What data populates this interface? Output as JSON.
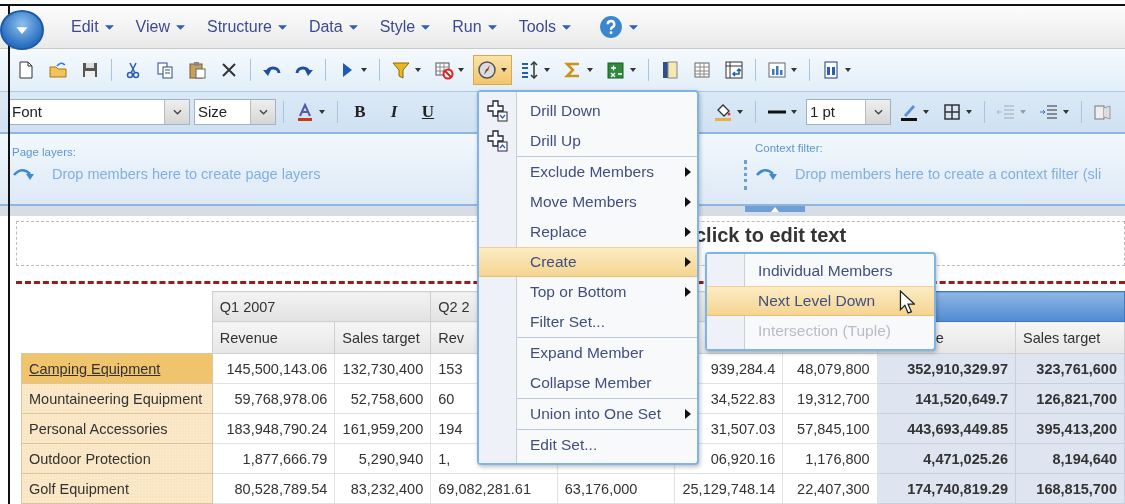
{
  "menubar": {
    "items": [
      "Edit",
      "View",
      "Structure",
      "Data",
      "Style",
      "Run",
      "Tools"
    ]
  },
  "toolbar": {
    "buttons": [
      {
        "kind": "new",
        "dropdown": false,
        "active": false
      },
      {
        "kind": "open",
        "dropdown": false,
        "active": false
      },
      {
        "kind": "save",
        "dropdown": false,
        "active": false
      },
      {
        "kind": "separator"
      },
      {
        "kind": "cut",
        "dropdown": false,
        "active": false
      },
      {
        "kind": "copy",
        "dropdown": false,
        "active": false
      },
      {
        "kind": "paste",
        "dropdown": false,
        "active": false
      },
      {
        "kind": "delete",
        "dropdown": false,
        "active": false
      },
      {
        "kind": "separator"
      },
      {
        "kind": "undo",
        "dropdown": false,
        "active": false
      },
      {
        "kind": "redo",
        "dropdown": false,
        "active": false
      },
      {
        "kind": "separator"
      },
      {
        "kind": "run",
        "dropdown": true,
        "active": false
      },
      {
        "kind": "separator"
      },
      {
        "kind": "filter",
        "dropdown": true,
        "active": false
      },
      {
        "kind": "block",
        "dropdown": true,
        "active": false
      },
      {
        "kind": "analysis",
        "dropdown": true,
        "active": true
      },
      {
        "kind": "sort",
        "dropdown": true,
        "active": false
      },
      {
        "kind": "sum",
        "dropdown": true,
        "active": false
      },
      {
        "kind": "calc",
        "dropdown": true,
        "active": false
      },
      {
        "kind": "separator"
      },
      {
        "kind": "column",
        "dropdown": false,
        "active": false
      },
      {
        "kind": "table",
        "dropdown": false,
        "active": false
      },
      {
        "kind": "swap",
        "dropdown": false,
        "active": false
      },
      {
        "kind": "separator"
      },
      {
        "kind": "chart",
        "dropdown": true,
        "active": false
      },
      {
        "kind": "separator"
      },
      {
        "kind": "document",
        "dropdown": true,
        "active": false
      }
    ]
  },
  "format_bar": {
    "items": [
      {
        "kind": "select",
        "value": "Font"
      },
      {
        "kind": "select",
        "value": "Size"
      },
      {
        "kind": "separator"
      },
      {
        "kind": "font-color",
        "dropdown": true,
        "disabled": false
      },
      {
        "kind": "separator"
      },
      {
        "kind": "bold",
        "label": "B",
        "disabled": false
      },
      {
        "kind": "italic",
        "label": "I",
        "disabled": false
      },
      {
        "kind": "underline",
        "label": "U",
        "disabled": false
      },
      {
        "kind": "hidden"
      },
      {
        "kind": "fill",
        "dropdown": true,
        "disabled": false
      },
      {
        "kind": "separator"
      },
      {
        "kind": "line",
        "dropdown": true,
        "disabled": false
      },
      {
        "kind": "select",
        "value": "1 pt"
      },
      {
        "kind": "pen",
        "dropdown": true,
        "disabled": false
      },
      {
        "kind": "borders",
        "dropdown": true,
        "disabled": false
      },
      {
        "kind": "separator"
      },
      {
        "kind": "outdent",
        "dropdown": true,
        "disabled": true
      },
      {
        "kind": "indent",
        "dropdown": true,
        "disabled": false
      },
      {
        "kind": "separator"
      },
      {
        "kind": "style",
        "dropdown": false,
        "disabled": false
      }
    ]
  },
  "page_layers": {
    "label": "Page layers:",
    "hint": "Drop members here to create page layers"
  },
  "context_filter": {
    "label": "Context filter:",
    "hint": "Drop members here to create a context filter (sli"
  },
  "report_title": {
    "text": "click to edit text"
  },
  "table": {
    "groups": [
      {
        "kind": "normal",
        "label": "Q1 2007",
        "headers": [
          "Revenue",
          "Sales target"
        ]
      },
      {
        "kind": "cut",
        "label": "Q2 2",
        "headers": [
          "Rev"
        ]
      },
      {
        "kind": "hidden"
      },
      {
        "kind": "summary",
        "headers": [
          "e",
          "Sales target"
        ]
      }
    ],
    "rows": [
      {
        "label": "Camping Equipment",
        "selected": true,
        "cells": [
          "145,500,143.06",
          "132,730,400",
          "153",
          null,
          "939,284.4",
          "48,079,800",
          "352,910,329.97",
          "323,761,600"
        ]
      },
      {
        "label": "Mountaineering Equipment",
        "selected": false,
        "cells": [
          "59,768,978.06",
          "52,758,600",
          "60",
          null,
          "34,522.83",
          "19,312,700",
          "141,520,649.7",
          "126,821,700"
        ]
      },
      {
        "label": "Personal Accessories",
        "selected": false,
        "cells": [
          "183,948,790.24",
          "161,959,200",
          "194",
          null,
          "31,507.03",
          "57,845,100",
          "443,693,449.85",
          "395,413,200"
        ]
      },
      {
        "label": "Outdoor Protection",
        "selected": false,
        "cells": [
          "1,877,666.79",
          "5,290,940",
          "1,",
          null,
          "06,920.16",
          "1,176,800",
          "4,471,025.26",
          "8,194,640"
        ]
      },
      {
        "label": "Golf Equipment",
        "selected": false,
        "cells": [
          "80,528,789.54",
          "83,232,400",
          "69,082,281.61",
          "63,176,000",
          "25,129,748.14",
          "22,407,300",
          "174,740,819.29",
          "168,815,700"
        ]
      }
    ]
  },
  "context_menu": {
    "items": [
      {
        "kind": "drill-down",
        "label": "Drill Down",
        "submenu": false,
        "highlighted": false
      },
      {
        "kind": "drill-up",
        "label": "Drill Up",
        "submenu": false,
        "highlighted": false
      },
      {
        "kind": "separator"
      },
      {
        "kind": "item",
        "label": "Exclude Members",
        "submenu": true,
        "highlighted": false
      },
      {
        "kind": "item",
        "label": "Move Members",
        "submenu": true,
        "highlighted": false
      },
      {
        "kind": "item",
        "label": "Replace",
        "submenu": true,
        "highlighted": false
      },
      {
        "kind": "item",
        "label": "Create",
        "submenu": true,
        "highlighted": true
      },
      {
        "kind": "item",
        "label": "Top or Bottom",
        "submenu": true,
        "highlighted": false
      },
      {
        "kind": "item",
        "label": "Filter Set...",
        "submenu": false,
        "highlighted": false
      },
      {
        "kind": "separator"
      },
      {
        "kind": "item",
        "label": "Expand Member",
        "submenu": false,
        "highlighted": false
      },
      {
        "kind": "item",
        "label": "Collapse Member",
        "submenu": false,
        "highlighted": false
      },
      {
        "kind": "separator"
      },
      {
        "kind": "item",
        "label": "Union into One Set",
        "submenu": true,
        "highlighted": false
      },
      {
        "kind": "separator"
      },
      {
        "kind": "item",
        "label": "Edit Set...",
        "submenu": false,
        "highlighted": false
      }
    ]
  },
  "submenu": {
    "items": [
      {
        "label": "Individual Members",
        "highlighted": false,
        "disabled": false
      },
      {
        "label": "Next Level Down",
        "highlighted": true,
        "disabled": false
      },
      {
        "label": "Intersection (Tuple)",
        "highlighted": false,
        "disabled": true
      }
    ]
  }
}
